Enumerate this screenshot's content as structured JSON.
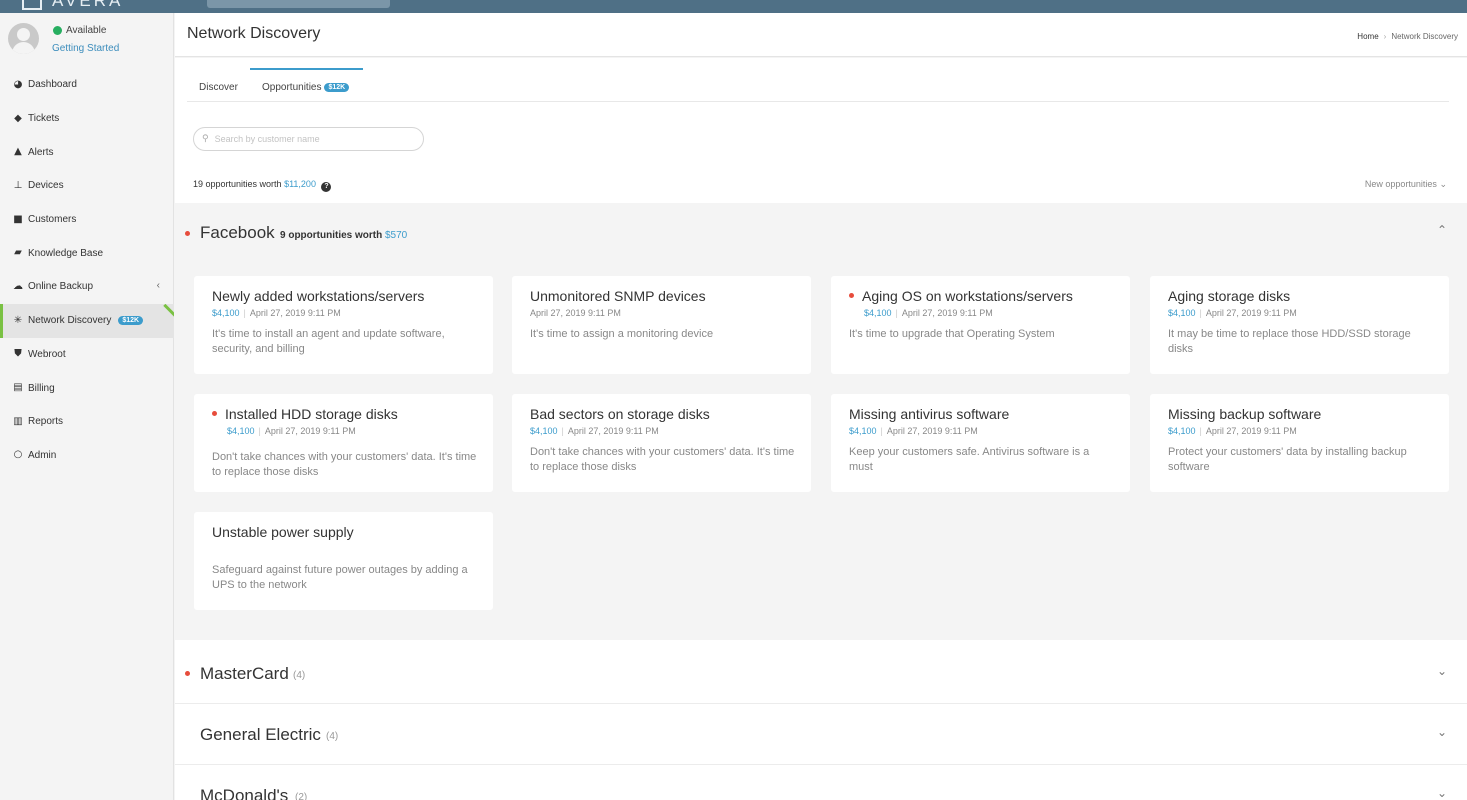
{
  "app": {
    "brand": "AVERA"
  },
  "user": {
    "status": "Available",
    "link": "Getting Started"
  },
  "sidebar": {
    "items": [
      {
        "label": "Dashboard",
        "icon": "dashboard-icon"
      },
      {
        "label": "Tickets",
        "icon": "tags-icon"
      },
      {
        "label": "Alerts",
        "icon": "warning-icon"
      },
      {
        "label": "Devices",
        "icon": "sitemap-icon"
      },
      {
        "label": "Customers",
        "icon": "briefcase-icon"
      },
      {
        "label": "Knowledge Base",
        "icon": "book-icon"
      },
      {
        "label": "Online Backup",
        "icon": "cloud-icon"
      },
      {
        "label": "Network Discovery",
        "icon": "network-icon",
        "badge": "$12K"
      },
      {
        "label": "Webroot",
        "icon": "shield-icon"
      },
      {
        "label": "Billing",
        "icon": "document-icon"
      },
      {
        "label": "Reports",
        "icon": "bar-chart-icon"
      },
      {
        "label": "Admin",
        "icon": "circle-icon"
      }
    ]
  },
  "header": {
    "title": "Network Discovery",
    "breadcrumb": {
      "home": "Home",
      "current": "Network Discovery"
    }
  },
  "tabs": {
    "discover": "Discover",
    "opportunities": "Opportunities",
    "opportunities_badge": "$12K"
  },
  "search": {
    "placeholder": "Search by customer name"
  },
  "summary": {
    "text": "19 opportunities worth",
    "worth": "$11,200",
    "sort": "New opportunities"
  },
  "groups": [
    {
      "name": "Facebook",
      "meta": "9 opportunities worth",
      "worth": "$570",
      "cards": [
        {
          "title": "Newly added workstations/servers",
          "price": "$4,100",
          "date": "April 27, 2019 9:11 PM",
          "desc": "It's time to install an agent and update software, security, and billing",
          "dot": false
        },
        {
          "title": "Unmonitored SNMP devices",
          "price": "",
          "date": "April 27, 2019 9:11 PM",
          "desc": "It's time to assign a monitoring device",
          "dot": false
        },
        {
          "title": "Aging OS on workstations/servers",
          "price": "$4,100",
          "date": "April 27, 2019 9:11 PM",
          "desc": "It's time to upgrade that Operating System",
          "dot": true
        },
        {
          "title": "Aging storage disks",
          "price": "$4,100",
          "date": "April 27, 2019 9:11 PM",
          "desc": "It may be time to replace those HDD/SSD storage disks",
          "dot": false
        },
        {
          "title": "Installed HDD storage disks",
          "price": "$4,100",
          "date": "April 27, 2019 9:11 PM",
          "desc": "Don't take chances with your customers' data. It's time to replace those disks",
          "dot": true
        },
        {
          "title": "Bad sectors on storage disks",
          "price": "$4,100",
          "date": "April 27, 2019 9:11 PM",
          "desc": "Don't take chances with your customers' data. It's time to replace those disks",
          "dot": false
        },
        {
          "title": "Missing antivirus software",
          "price": "$4,100",
          "date": "April 27, 2019 9:11 PM",
          "desc": "Keep your customers safe. Antivirus software is a must",
          "dot": false
        },
        {
          "title": "Missing backup software",
          "price": "$4,100",
          "date": "April 27, 2019 9:11 PM",
          "desc": "Protect your customers' data by installing backup software",
          "dot": false
        },
        {
          "title": "Unstable power supply",
          "price": "",
          "date": "",
          "desc": "Safeguard against future power outages by adding a UPS to the network",
          "dot": false
        }
      ]
    },
    {
      "name": "MasterCard",
      "count": "(4)"
    },
    {
      "name": "General Electric",
      "count": "(4)"
    },
    {
      "name": "McDonald's",
      "count": "(2)"
    }
  ]
}
